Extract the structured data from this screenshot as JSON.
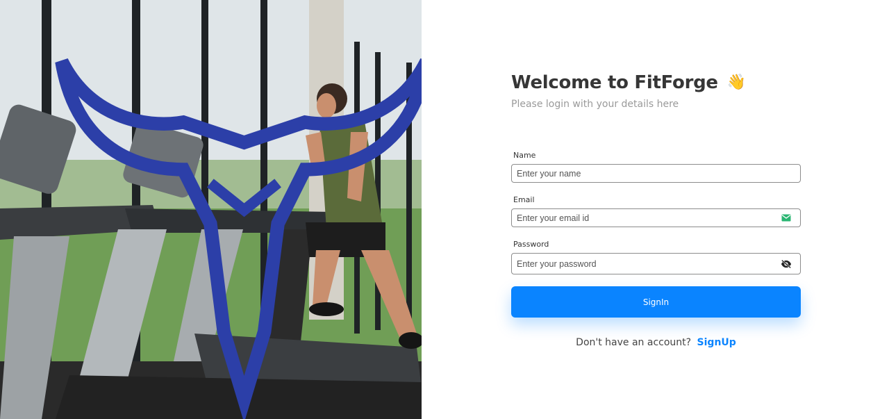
{
  "brand": {
    "logo_icon": "bull-skull-icon"
  },
  "hero": {
    "image": "gym-treadmill-runner-photo"
  },
  "header": {
    "title": "Welcome to FitForge",
    "title_emoji": "👋",
    "subtitle": "Please login with your details here"
  },
  "form": {
    "name": {
      "label": "Name",
      "placeholder": "Enter your name",
      "value": ""
    },
    "email": {
      "label": "Email",
      "placeholder": "Enter your email id",
      "value": "",
      "icon": "mail-icon"
    },
    "password": {
      "label": "Password",
      "placeholder": "Enter your password",
      "value": "",
      "icon": "eye-off-icon"
    },
    "submit_label": "SignIn"
  },
  "footer": {
    "prompt": "Don't have an account?",
    "link_label": "SignUp"
  },
  "colors": {
    "accent": "#0a84ff",
    "title": "#363636",
    "subtitle": "#9a9a9a",
    "mail_icon": "#2bb673"
  }
}
